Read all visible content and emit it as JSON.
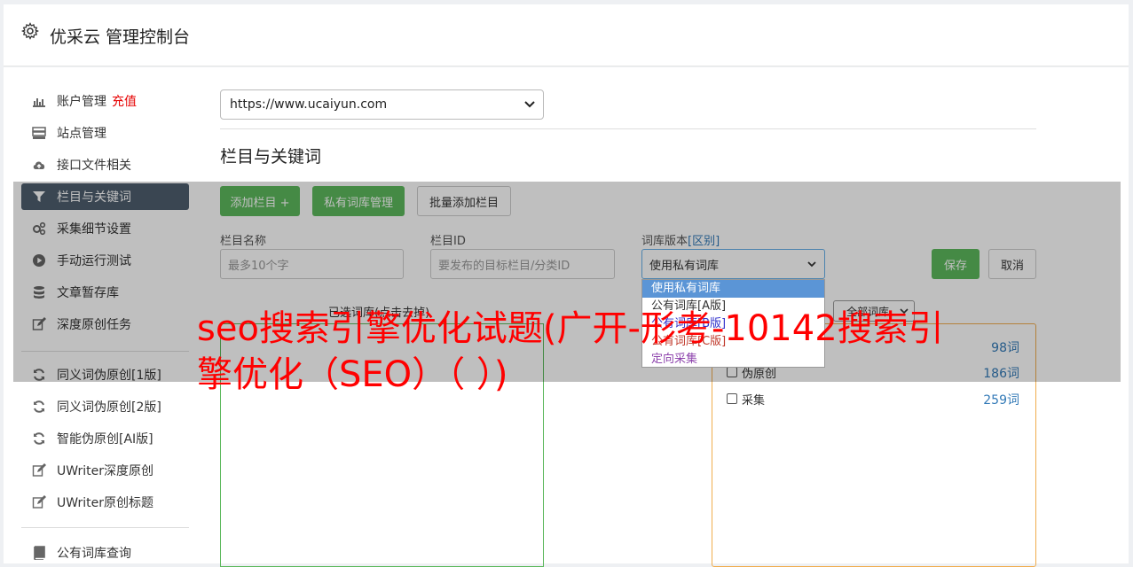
{
  "header": {
    "title": "优采云 管理控制台",
    "icon": "gear-icon"
  },
  "sidebar": {
    "items": [
      {
        "label": "账户管理",
        "badge": "充值",
        "icon": "bar-chart-icon"
      },
      {
        "label": "站点管理",
        "icon": "server-icon"
      },
      {
        "label": "接口文件相关",
        "icon": "cloud-upload-icon"
      },
      {
        "label": "栏目与关键词",
        "icon": "filter-icon",
        "active": true
      },
      {
        "label": "采集细节设置",
        "icon": "cogs-icon"
      },
      {
        "label": "手动运行测试",
        "icon": "play-circle-icon"
      },
      {
        "label": "文章暂存库",
        "icon": "database-icon"
      },
      {
        "label": "深度原创任务",
        "icon": "edit-icon"
      },
      {
        "label": "同义词伪原创[1版]",
        "icon": "refresh-icon"
      },
      {
        "label": "同义词伪原创[2版]",
        "icon": "refresh-icon"
      },
      {
        "label": "智能伪原创[AI版]",
        "icon": "refresh-icon"
      },
      {
        "label": "UWriter深度原创",
        "icon": "edit-icon"
      },
      {
        "label": "UWriter原创标题",
        "icon": "edit-icon"
      },
      {
        "label": "公有词库查询",
        "icon": "book-icon"
      }
    ]
  },
  "main": {
    "site_select": "https://www.ucaiyun.com",
    "section_title": "栏目与关键词",
    "buttons": {
      "add_column": "添加栏目 +",
      "private_lib": "私有词库管理",
      "batch_add": "批量添加栏目",
      "save": "保存",
      "cancel": "取消"
    },
    "form": {
      "column_name_label": "栏目名称",
      "column_name_placeholder": "最多10个字",
      "column_id_label": "栏目ID",
      "column_id_placeholder": "要发布的目标栏目/分类ID",
      "lib_version_label": "词库版本",
      "lib_version_link": "[区别]",
      "lib_version_value": "使用私有词库"
    },
    "dropdown_options": [
      {
        "label": "使用私有词库",
        "color": "#ffffff"
      },
      {
        "label": "公有词库[A版]",
        "color": "#333333"
      },
      {
        "label": "公有词库[B版]",
        "color": "#3333cc"
      },
      {
        "label": "公有词库[C版]",
        "color": "#c0392b"
      },
      {
        "label": "定向采集",
        "color": "#8e44ad"
      }
    ],
    "selected_words_header": "已选词库(点击去掉)",
    "lib_filter": "全部词库",
    "libraries": [
      {
        "name": "",
        "count": "98词"
      },
      {
        "name": "伪原创",
        "count": "186词"
      },
      {
        "name": "采集",
        "count": "259词"
      }
    ]
  },
  "overlay_text": "seo搜索引擎优化试题(广开-形考-10142搜索引擎优化（SEO）（ ）)",
  "colors": {
    "accent_green": "#5cb85c",
    "active_nav": "#4e5e6e",
    "overlay_red": "#ff0000"
  }
}
